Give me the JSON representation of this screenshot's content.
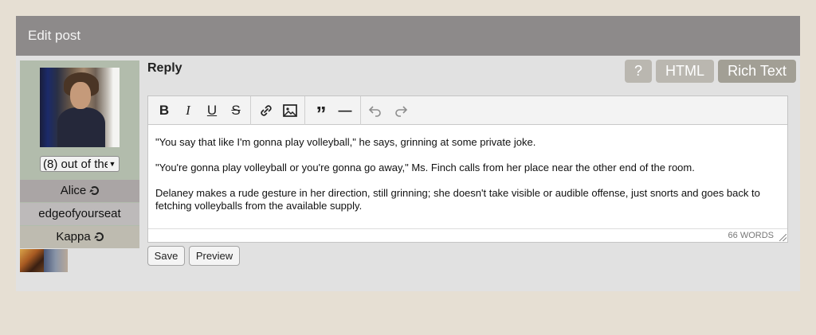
{
  "header": {
    "title": "Edit post"
  },
  "sidebar": {
    "character_select": {
      "value": "(8) out of the"
    },
    "rows": [
      {
        "label": "Alice",
        "icon": "refresh-icon"
      },
      {
        "label": "edgeofyourseat"
      },
      {
        "label": "Kappa",
        "icon": "refresh-icon"
      }
    ]
  },
  "editor": {
    "section_label": "Reply",
    "mode_buttons": {
      "help": "?",
      "html": "HTML",
      "rich_text": "Rich Text"
    },
    "toolbar": {
      "bold": "B",
      "italic": "I",
      "underline": "U",
      "strike": "S",
      "quote": "”",
      "hr": "—"
    },
    "paragraphs": [
      "\"You say that like I'm gonna play volleyball,\" he says, grinning at some private joke.",
      "\"You're gonna play volleyball or you're gonna go away,\" Ms. Finch calls from her place near the other end of the room.",
      "Delaney makes a rude gesture in her direction, still grinning; she doesn't take visible or audible offense, just snorts and goes back to fetching volleyballs from the available supply."
    ],
    "word_count": "66 WORDS"
  },
  "actions": {
    "save": "Save",
    "preview": "Preview"
  },
  "colors": {
    "header_bg": "#8d8a8a",
    "panel_bg": "#e1e1e1",
    "sidebar_bg": "#b2bcac",
    "active_mode": "#a29f95"
  }
}
